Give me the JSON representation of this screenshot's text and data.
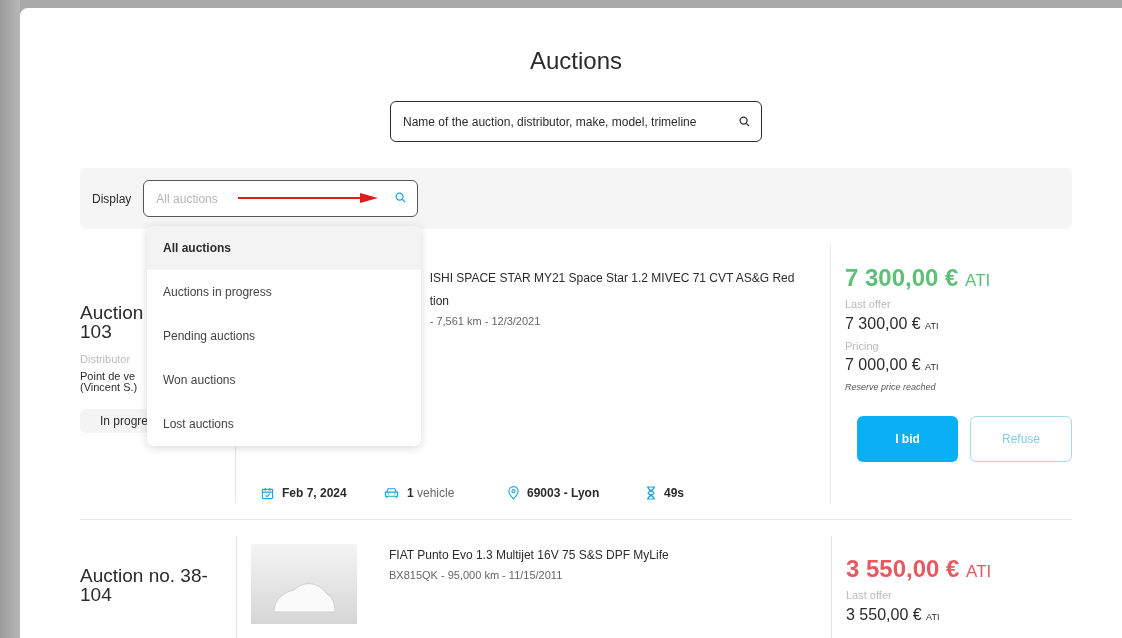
{
  "page_title": "Auctions",
  "search": {
    "placeholder": "Name of the auction, distributor, make, model, trimeline"
  },
  "filter": {
    "label": "Display",
    "placeholder": "All auctions",
    "expanded": true,
    "options": [
      {
        "label": "All auctions",
        "selected": true
      },
      {
        "label": "Auctions in progress",
        "selected": false
      },
      {
        "label": "Pending auctions",
        "selected": false
      },
      {
        "label": "Won auctions",
        "selected": false
      },
      {
        "label": "Lost auctions",
        "selected": false
      }
    ]
  },
  "auctions": [
    {
      "title_lines": [
        "Auction",
        "103"
      ],
      "distributor_label": "Distributor",
      "distributor_lines": [
        "Point de ve",
        "(Vincent S.)"
      ],
      "status": "In progre",
      "photo": false,
      "vehicle_lines": [
        "ISHI SPACE STAR MY21 Space Star 1.2 MIVEC 71 CVT AS&G Red",
        "tion"
      ],
      "details": "- 7,561 km - 12/3/2021",
      "info": [
        {
          "kind": "date",
          "value": "Feb 7, 2024"
        },
        {
          "kind": "vehicles",
          "value": "1",
          "suffix": "vehicle"
        },
        {
          "kind": "location",
          "value": "69003 - Lyon"
        },
        {
          "kind": "time",
          "value": "49s"
        }
      ],
      "price": "7 300,00 €",
      "price_unit": "ATI",
      "color": "#5cc076",
      "last_offer_label": "Last offer",
      "last_offer": "7 300,00 €",
      "last_offer_unit": "ATI",
      "pricing_label": "Pricing",
      "pricing": "7 000,00 €",
      "pricing_unit": "ATI",
      "note": "Reserve price reached",
      "buttons": [
        {
          "kind": "primary",
          "label": "I bid"
        },
        {
          "kind": "secondary",
          "label": "Refuse"
        }
      ]
    },
    {
      "title_lines": [
        "Auction no. 38-",
        "104"
      ],
      "photo": true,
      "vehicle_lines": [
        "FIAT Punto Evo 1.3 Multijet 16V 75 S&S DPF MyLife"
      ],
      "details": "BX815QK - 95,000 km - 11/15/2011",
      "price": "3 550,00 €",
      "price_unit": "ATI",
      "color": "#e8595f",
      "last_offer_label": "Last offer",
      "last_offer": "3 550,00 €",
      "last_offer_unit": "ATI"
    }
  ]
}
